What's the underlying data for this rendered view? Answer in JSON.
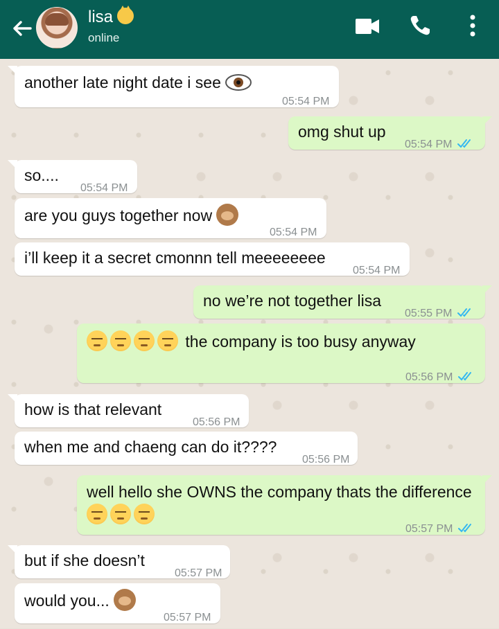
{
  "header": {
    "contact_name": "lisa",
    "status": "online",
    "icons": [
      "back-arrow-icon",
      "video-call-icon",
      "phone-icon",
      "more-options-icon"
    ]
  },
  "colors": {
    "header": "#075e54",
    "incoming": "#ffffff",
    "outgoing": "#dcf8c6",
    "read_ticks": "#34b7f1"
  },
  "messages": [
    {
      "direction": "in",
      "text": "another late night date i see",
      "time": "05:54 PM"
    },
    {
      "direction": "out",
      "text": "omg shut up",
      "time": "05:54 PM"
    },
    {
      "direction": "in",
      "text": "so....",
      "time": "05:54 PM"
    },
    {
      "direction": "in",
      "text": "are you guys together now",
      "time": "05:54 PM"
    },
    {
      "direction": "in",
      "text": "i’ll keep it a secret cmonnn tell meeeeeeee",
      "time": "05:54 PM"
    },
    {
      "direction": "out",
      "text": "no we’re not together lisa",
      "time": "05:55 PM"
    },
    {
      "direction": "out",
      "text": "the company is too busy anyway",
      "time": "05:56 PM"
    },
    {
      "direction": "in",
      "text": "how is that relevant",
      "time": "05:56 PM"
    },
    {
      "direction": "in",
      "text": "when me and chaeng can do it????",
      "time": "05:56 PM"
    },
    {
      "direction": "out",
      "text": "well hello she OWNS the company thats the difference",
      "time": "05:57 PM"
    },
    {
      "direction": "in",
      "text": "but if she doesn’t",
      "time": "05:57 PM"
    },
    {
      "direction": "in",
      "text": "would you...",
      "time": "05:57 PM"
    }
  ]
}
